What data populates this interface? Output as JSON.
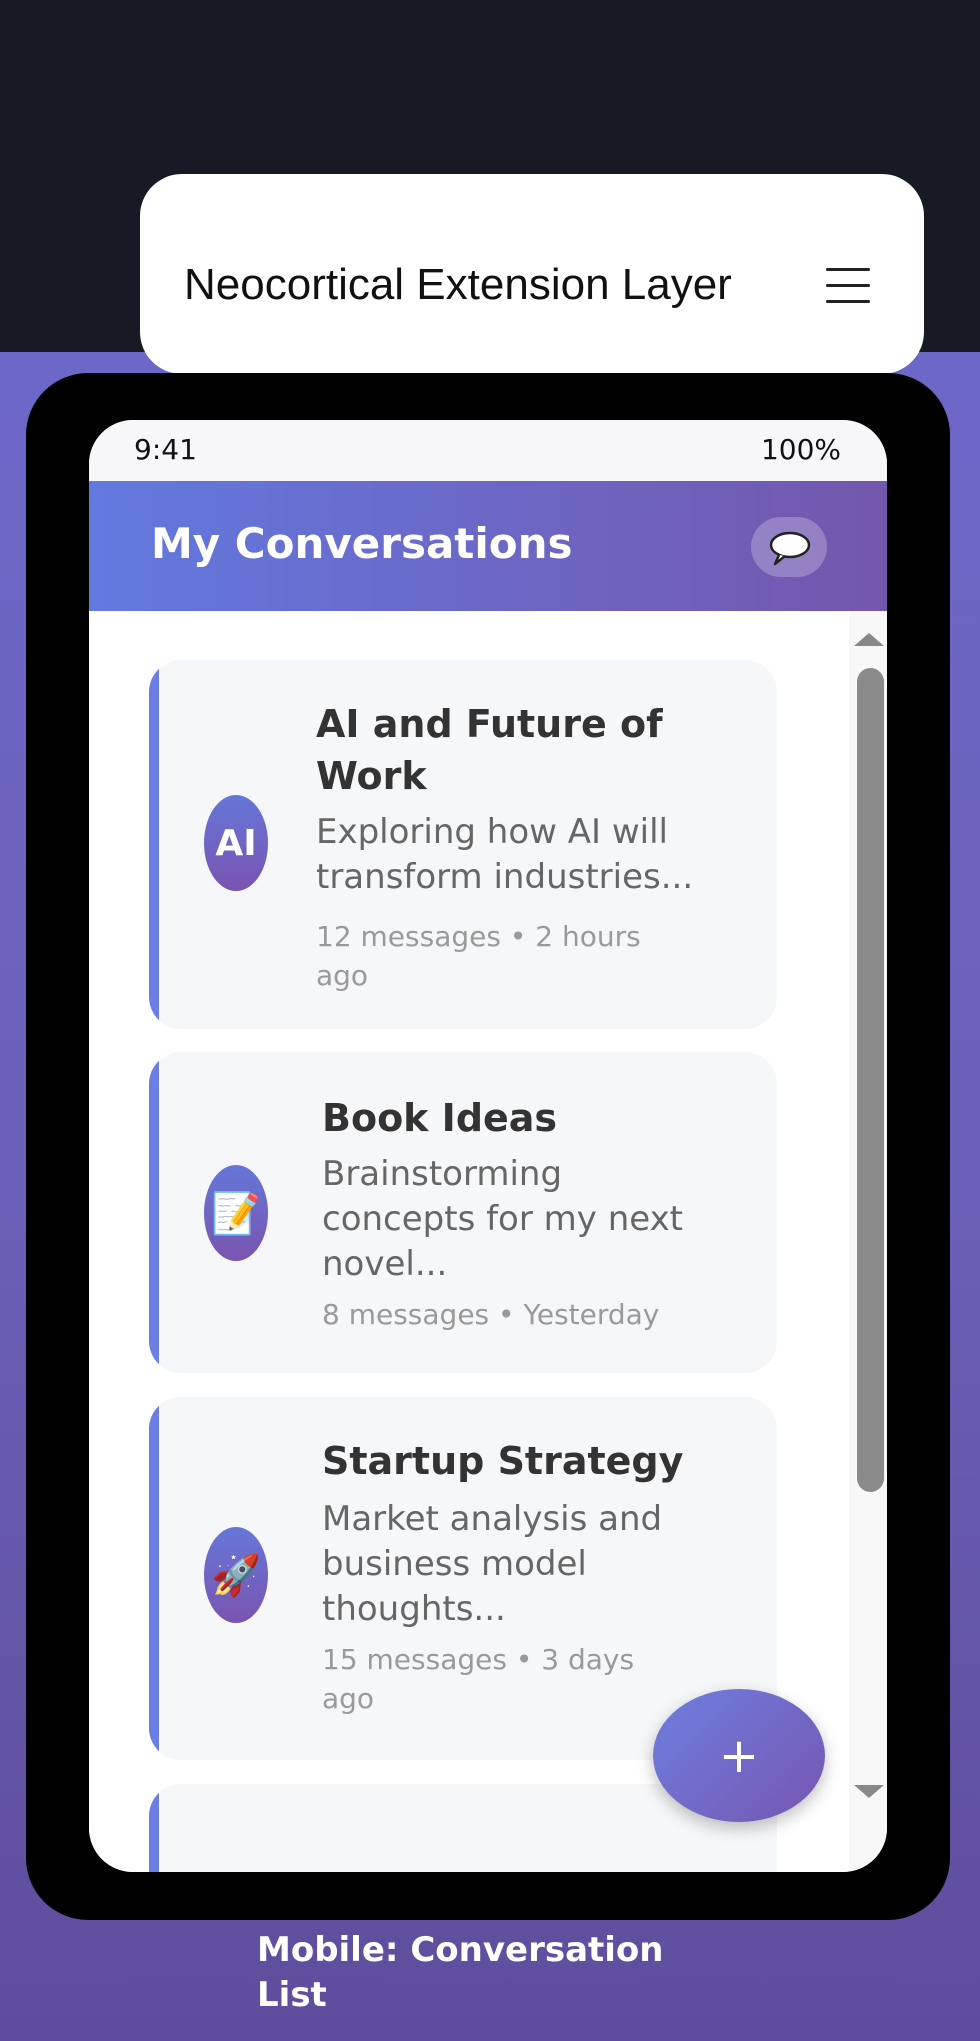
{
  "window": {
    "title": "Neocortical Extension Layer",
    "menu_icon": "hamburger-menu-icon"
  },
  "status_bar": {
    "time": "9:41",
    "battery": "100%"
  },
  "header": {
    "title": "My Conversations",
    "action_icon": "speech-bubble-icon"
  },
  "conversations": [
    {
      "avatar": "AI",
      "title_line1": "AI and Future of",
      "title_line2": "Work",
      "desc_line1": "Exploring how AI will",
      "desc_line2": "transform industries...",
      "meta_line1": "12 messages • 2 hours",
      "meta_line2": "ago"
    },
    {
      "avatar": "📝",
      "avatar_icon": "memo-icon",
      "title_line1": "Book Ideas",
      "desc_line1": "Brainstorming",
      "desc_line2": "concepts for my next",
      "desc_line3": "novel...",
      "meta_line1": "8 messages • Yesterday"
    },
    {
      "avatar": "🚀",
      "avatar_icon": "rocket-icon",
      "title_line1": "Startup Strategy",
      "desc_line1": "Market analysis and",
      "desc_line2": "business model",
      "desc_line3": "thoughts...",
      "meta_line1": "15 messages • 3 days",
      "meta_line2": "ago"
    }
  ],
  "fab": {
    "label": "+"
  },
  "caption": {
    "line1": "Mobile: Conversation",
    "line2": "List"
  }
}
